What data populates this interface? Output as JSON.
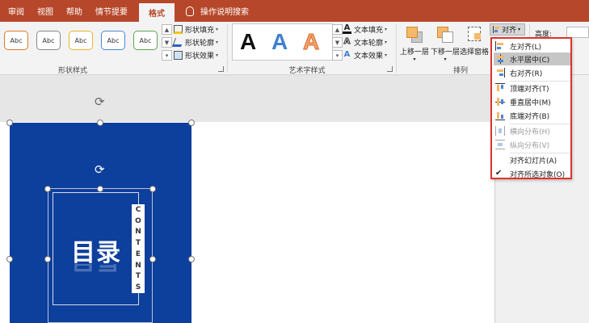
{
  "tabs": [
    {
      "label": "审阅"
    },
    {
      "label": "视图"
    },
    {
      "label": "帮助"
    },
    {
      "label": "情节提要"
    },
    {
      "label": "格式",
      "active": true
    }
  ],
  "tell_me": "操作说明搜索",
  "ribbon": {
    "shape_styles": {
      "label": "形状样式",
      "gallery": [
        {
          "text": "Abc",
          "color": "#e07a2e"
        },
        {
          "text": "Abc",
          "color": "#888888"
        },
        {
          "text": "Abc",
          "color": "#e8b526"
        },
        {
          "text": "Abc",
          "color": "#4a86d4"
        },
        {
          "text": "Abc",
          "color": "#5aa84e"
        }
      ],
      "fill": "形状填充",
      "outline": "形状轮廓",
      "effects": "形状效果"
    },
    "wordart": {
      "label": "艺术字样式",
      "letters": [
        {
          "text": "A",
          "color": "#111111"
        },
        {
          "text": "A",
          "color": "#3f7fd0"
        },
        {
          "text": "A",
          "color": "#f1a66a"
        }
      ],
      "text_fill": "文本填充",
      "text_outline": "文本轮廓",
      "text_effects": "文本效果"
    },
    "arrange": {
      "label": "排列",
      "bring_forward": "上移一层",
      "send_backward": "下移一层",
      "selection_pane": "选择窗格",
      "align": "对齐"
    },
    "size": {
      "height_label": "高度:"
    }
  },
  "slide": {
    "title": "目录",
    "contents_letters": [
      "C",
      "O",
      "N",
      "T",
      "E",
      "N",
      "T",
      "S"
    ],
    "shape_color": "#0d3f9c"
  },
  "align_menu": {
    "items": [
      {
        "label": "左对齐(L)",
        "icon": "align-left-icon",
        "disabled": false
      },
      {
        "label": "水平居中(C)",
        "icon": "align-center-icon",
        "disabled": false,
        "highlighted": true
      },
      {
        "label": "右对齐(R)",
        "icon": "align-right-icon",
        "disabled": false
      },
      {
        "label": "顶端对齐(T)",
        "icon": "align-top-icon",
        "disabled": false
      },
      {
        "label": "垂直居中(M)",
        "icon": "align-middle-icon",
        "disabled": false
      },
      {
        "label": "底端对齐(B)",
        "icon": "align-bottom-icon",
        "disabled": false
      },
      {
        "label": "横向分布(H)",
        "icon": "distribute-horizontal-icon",
        "disabled": true
      },
      {
        "label": "纵向分布(V)",
        "icon": "distribute-vertical-icon",
        "disabled": true
      },
      {
        "label": "对齐幻灯片(A)",
        "icon": "",
        "disabled": false
      },
      {
        "label": "对齐所选对象(O)",
        "icon": "checkmark-icon",
        "disabled": false,
        "checked": true
      }
    ]
  },
  "colors": {
    "accent": "#b7472a",
    "menu_border": "#e0322b"
  }
}
